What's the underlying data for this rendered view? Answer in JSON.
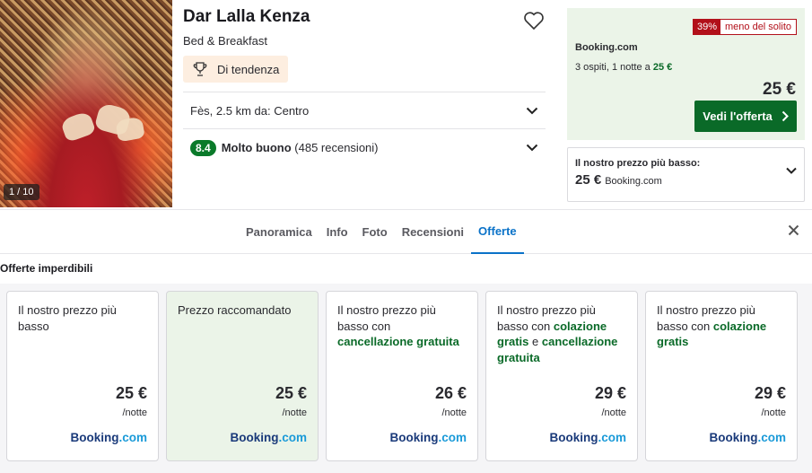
{
  "photo": {
    "counter": "1 / 10"
  },
  "hotel": {
    "name": "Dar Lalla Kenza",
    "type": "Bed & Breakfast",
    "badge": "Di tendenza",
    "location": "Fès, 2.5 km da: Centro",
    "rating": {
      "score": "8.4",
      "label": "Molto buono",
      "reviews": "(485 recensioni)"
    }
  },
  "deal": {
    "discount_pct": "39%",
    "discount_text": "meno del solito",
    "provider": "Booking.com",
    "guests_text": "3 ospiti, 1 notte a ",
    "guests_price": "25 €",
    "price": "25 €",
    "button": "Vedi l'offerta"
  },
  "lowest": {
    "label": "Il nostro prezzo più basso:",
    "price": "25 €",
    "provider": "Booking.com"
  },
  "tabs": [
    "Panoramica",
    "Info",
    "Foto",
    "Recensioni",
    "Offerte"
  ],
  "active_tab": "Offerte",
  "section_title": "Offerte imperdibili",
  "offers": [
    {
      "desc_plain": "Il nostro prezzo più basso",
      "price": "25 €",
      "per": "/notte"
    },
    {
      "desc_plain": "Prezzo raccomandato",
      "price": "25 €",
      "per": "/notte"
    },
    {
      "desc_a": "Il nostro prezzo più basso con ",
      "desc_b": "cancellazione gratuita",
      "price": "26 €",
      "per": "/notte"
    },
    {
      "desc_a": "Il nostro prezzo più basso con ",
      "desc_b": "colazione gratis",
      "desc_c": " e ",
      "desc_d": "cancellazione gratuita",
      "price": "29 €",
      "per": "/notte"
    },
    {
      "desc_a": "Il nostro prezzo più basso con ",
      "desc_b": "colazione gratis",
      "price": "29 €",
      "per": "/notte"
    }
  ],
  "logo": {
    "part1": "Booking",
    "part2": ".com"
  },
  "colors": {
    "green": "#0a6a28",
    "blue_tab": "#0a72c8",
    "discount_red": "#b2101a"
  },
  "icons": [
    "heart-icon",
    "trophy-icon",
    "chevron-down-icon",
    "chevron-right-icon",
    "close-icon"
  ]
}
